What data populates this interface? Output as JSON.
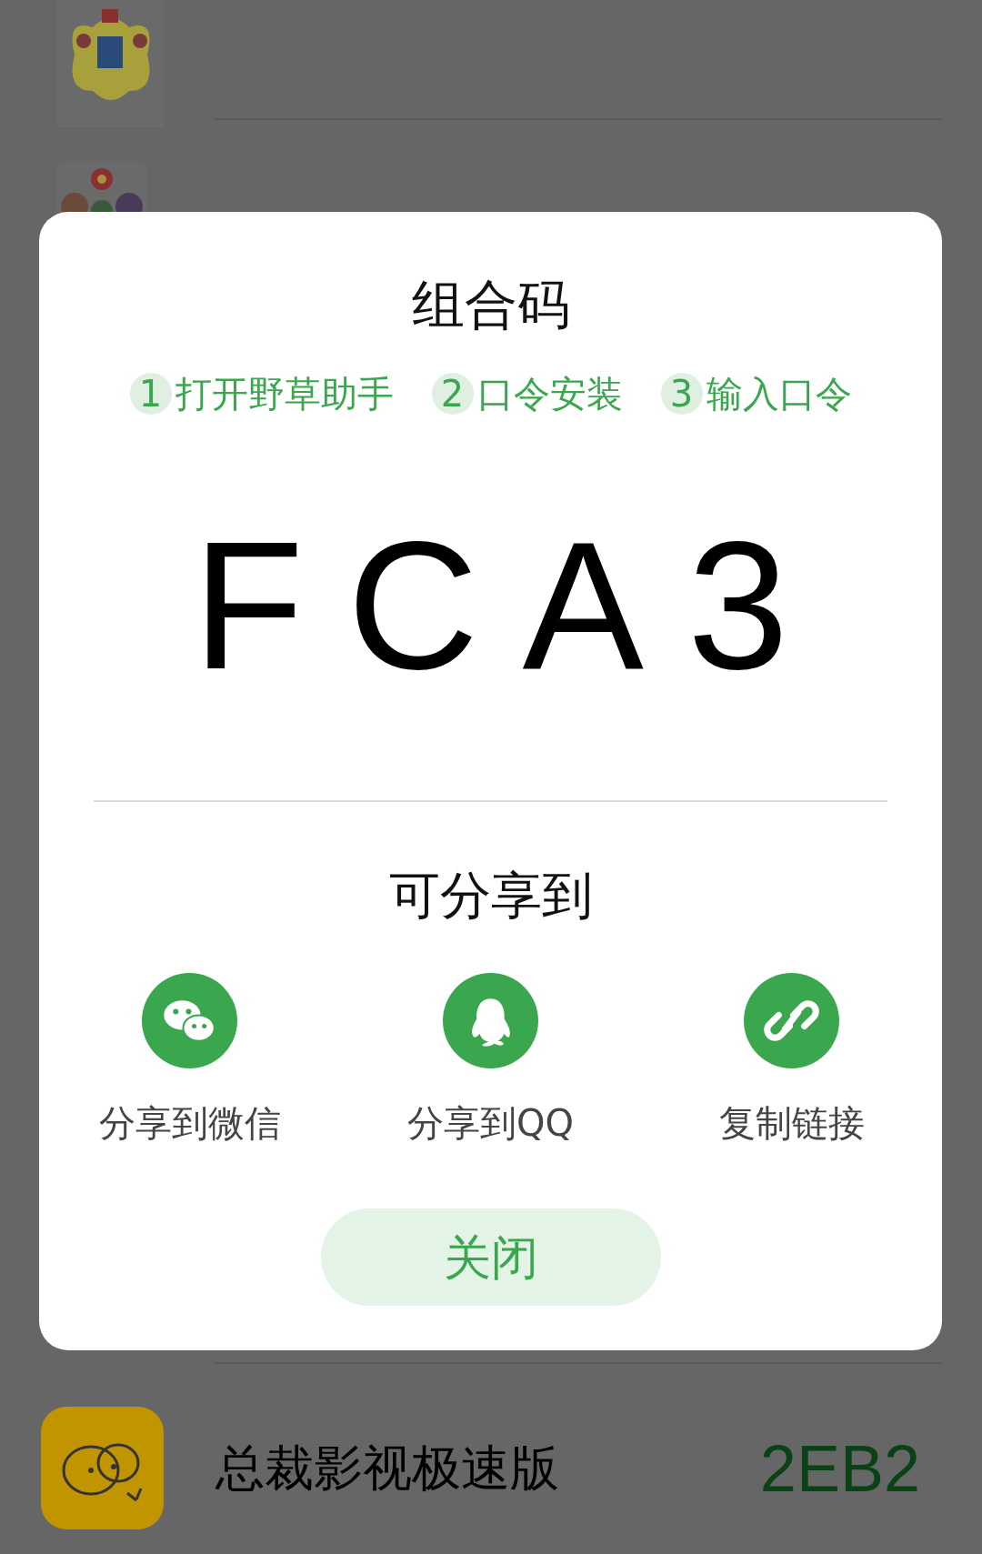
{
  "list": [
    {
      "name": "总裁影视极速版",
      "code": "2EB2"
    }
  ],
  "dialog": {
    "title": "组合码",
    "steps": [
      {
        "number": "1",
        "label": "打开野草助手"
      },
      {
        "number": "2",
        "label": "口令安装"
      },
      {
        "number": "3",
        "label": "输入口令"
      }
    ],
    "code": "FCA3",
    "share_title": "可分享到",
    "share_options": [
      {
        "kind": "wechat",
        "label": "分享到微信"
      },
      {
        "kind": "qq",
        "label": "分享到QQ"
      },
      {
        "kind": "link",
        "label": "复制链接"
      }
    ],
    "close_button": "关闭"
  }
}
